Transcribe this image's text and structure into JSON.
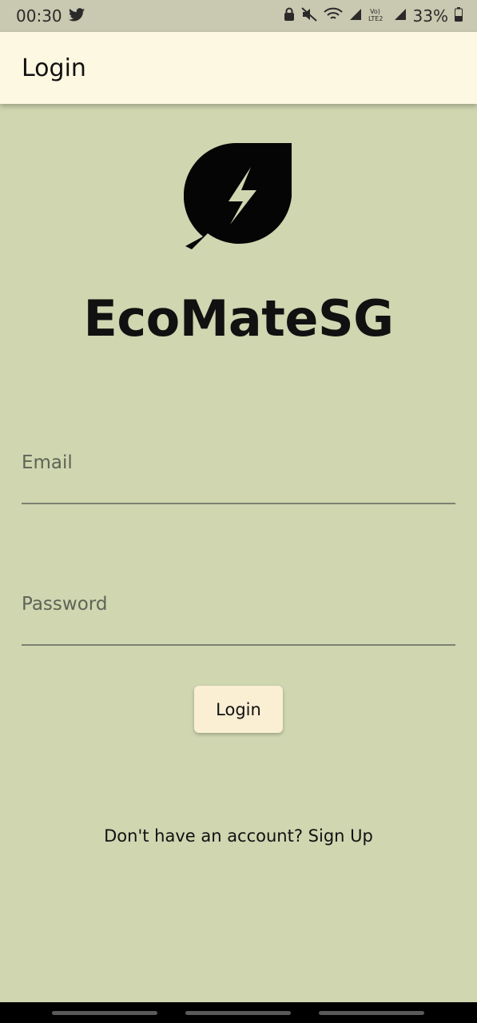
{
  "status_bar": {
    "time": "00:30",
    "battery": "33%",
    "icons": [
      "twitter-icon",
      "lock-icon",
      "mute-icon",
      "wifi-icon",
      "signal-icon",
      "volte-icon",
      "battery-icon"
    ]
  },
  "app_bar": {
    "title": "Login"
  },
  "brand": {
    "name": "EcoMateSG",
    "logo_icon": "leaf-bolt-icon"
  },
  "form": {
    "email_label": "Email",
    "password_label": "Password",
    "login_label": "Login"
  },
  "signup": {
    "text": "Don't have an account? Sign Up"
  },
  "colors": {
    "background": "#cfd6b0",
    "app_bar": "#fdf8e1",
    "button": "#faeed3"
  }
}
